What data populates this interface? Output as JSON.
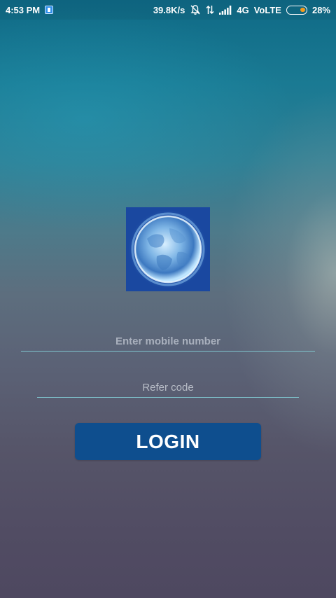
{
  "status_bar": {
    "time": "4:53 PM",
    "network_speed": "39.8K/s",
    "network_type": "4G",
    "volte": "VoLTE",
    "battery_percent": "28%",
    "battery_level": 0.28,
    "icons": [
      "notification-app-icon",
      "bell-muted-icon",
      "data-transfer-icon",
      "signal-icon",
      "battery-icon"
    ],
    "battery_color": "#f39a1c"
  },
  "logo": {
    "icon": "glowing-planet-logo"
  },
  "form": {
    "mobile_placeholder": "Enter mobile number",
    "mobile_value": "",
    "refer_placeholder": "Refer code",
    "refer_value": "",
    "login_label": "LOGIN"
  },
  "colors": {
    "button_bg": "#0e4e8e",
    "underline": "#7fc6cf",
    "background_top": "#0f6a86",
    "background_bottom": "#4e4860"
  }
}
